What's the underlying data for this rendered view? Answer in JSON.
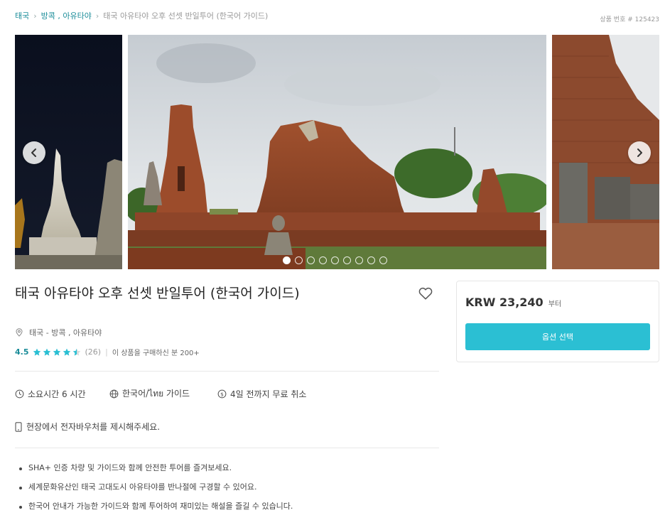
{
  "breadcrumb": {
    "items": [
      {
        "label": "태국"
      },
      {
        "label": "방콕 , 아유타야"
      },
      {
        "label": "태국 아유타야 오후 선셋 반일투어 (한국어 가이드)"
      }
    ],
    "separator": "›"
  },
  "product_number": "상품 번호 # 125423",
  "gallery": {
    "total_slides": 9,
    "active_slide_index": 0,
    "prev_icon": "chevron-left-icon",
    "next_icon": "chevron-right-icon"
  },
  "product": {
    "title": "태국 아유타야 오후 선셋 반일투어 (한국어 가이드)",
    "location": "태국 - 방콕 , 아유타야",
    "rating": {
      "score": "4.5",
      "stars": 4.5,
      "review_count": "(26)",
      "separator": "|",
      "purchase_note": "이 상품을 구매하신 분 200+"
    }
  },
  "info": {
    "duration": "소요시간 6 시간",
    "language": "한국어/ไทย 가이드",
    "cancellation": "4일 전까지 무료 취소",
    "voucher": "현장에서 전자바우처를 제시해주세요."
  },
  "highlights": [
    "SHA+ 인증 차량 및 가이드와 함께 안전한 투어를 즐겨보세요.",
    "세계문화유산인 태국 고대도시 아유타야를 반나절에 구경할 수 있어요.",
    "한국어 안내가 가능한 가이드와 함께 투어하여 재미있는 해설을 즐길 수 있습니다."
  ],
  "price_card": {
    "price": "KRW 23,240",
    "suffix": "부터",
    "button_label": "옵션 선택"
  },
  "colors": {
    "accent": "#1a8c99",
    "button": "#2bbfd3",
    "star": "#2bbfd3"
  }
}
